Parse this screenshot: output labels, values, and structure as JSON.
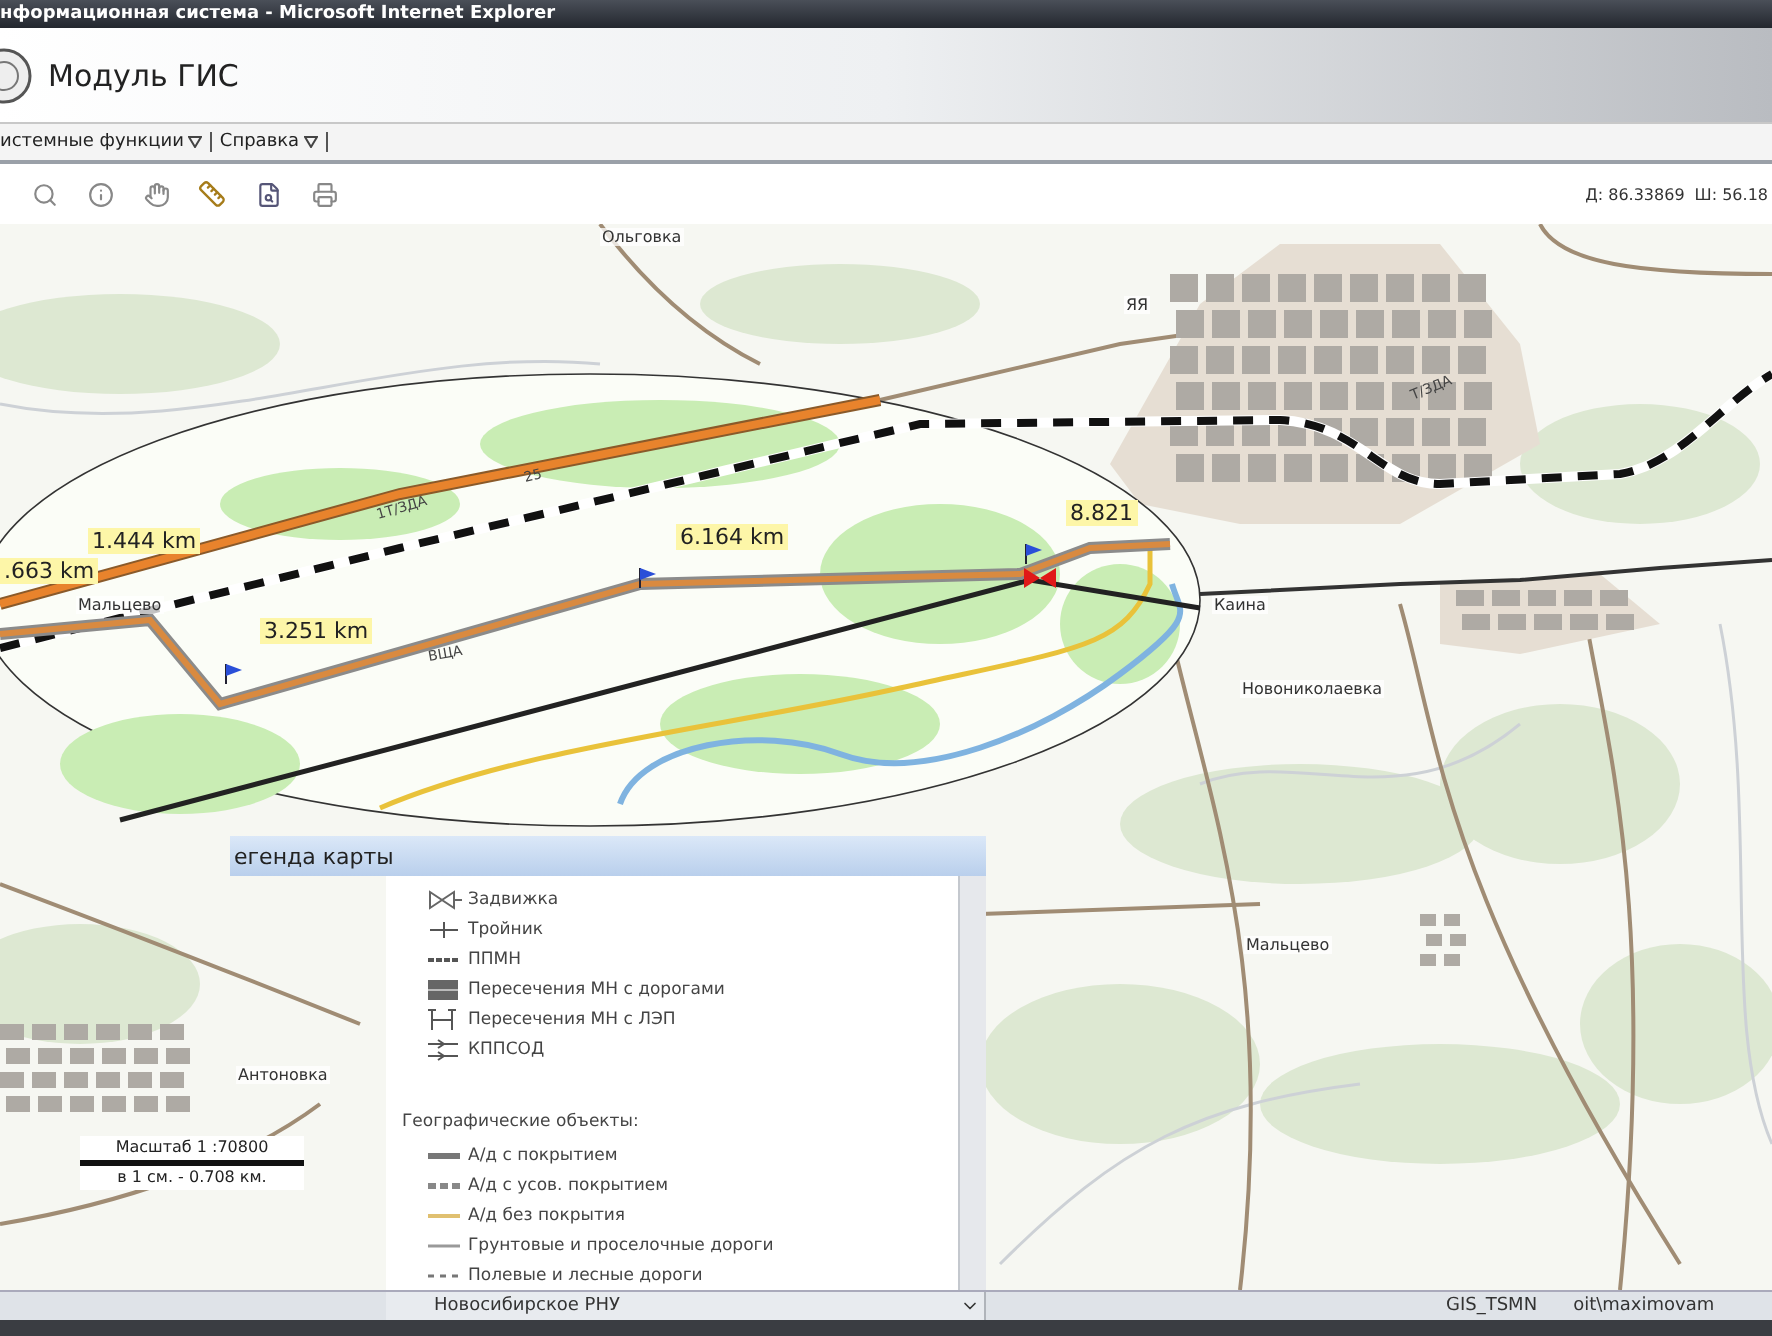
{
  "window": {
    "title": "нформационная система - Microsoft Internet Explorer"
  },
  "header": {
    "title": "Модуль ГИС"
  },
  "menu": [
    {
      "label": "истемные функции"
    },
    {
      "label": "Справка"
    }
  ],
  "toolbar": {
    "coordinates": [
      "Д: 86.33869",
      "Ш: 56.18"
    ]
  },
  "map": {
    "places": [
      "Ольговка",
      "ЯЯ",
      "Мальцево",
      "Каина",
      "Новониколаевка",
      "Мальцево",
      "Антоновка"
    ],
    "road_labels": [
      "1Т/ЗДА",
      "25",
      "ВЩА",
      "Т/ЗДА"
    ],
    "distances": [
      "1.444 km",
      ".663 km",
      "6.164 km",
      "3.251 km",
      "8.821"
    ],
    "scale": {
      "ratio": "Масштаб 1 :70800",
      "per_cm": "в 1 см. - 0.708 км."
    }
  },
  "legend": {
    "title": "егенда карты",
    "items": [
      {
        "label": "Задвижка",
        "kind": "valve"
      },
      {
        "label": "Тройник",
        "kind": "tee"
      },
      {
        "label": "ППМН",
        "kind": "ppmn"
      },
      {
        "label": "Пересечения МН с дорогами",
        "kind": "road-crossing"
      },
      {
        "label": "Пересечения МН с ЛЭП",
        "kind": "power-crossing"
      },
      {
        "label": "КППСОД",
        "kind": "kppsod"
      }
    ],
    "section_title": "Географические объекты:",
    "geo_items": [
      {
        "label": "А/д с покрытием",
        "kind": "paved"
      },
      {
        "label": "А/д с усов. покрытием",
        "kind": "improved"
      },
      {
        "label": "А/д без покрытия",
        "kind": "unpaved"
      },
      {
        "label": "Грунтовые и проселочные дороги",
        "kind": "dirt"
      },
      {
        "label": "Полевые и лесные дороги",
        "kind": "field"
      }
    ]
  },
  "status_bar": {
    "region": "Новосибирское РНУ",
    "database": "GIS_TSMN",
    "user": "oit\\maximovam"
  }
}
